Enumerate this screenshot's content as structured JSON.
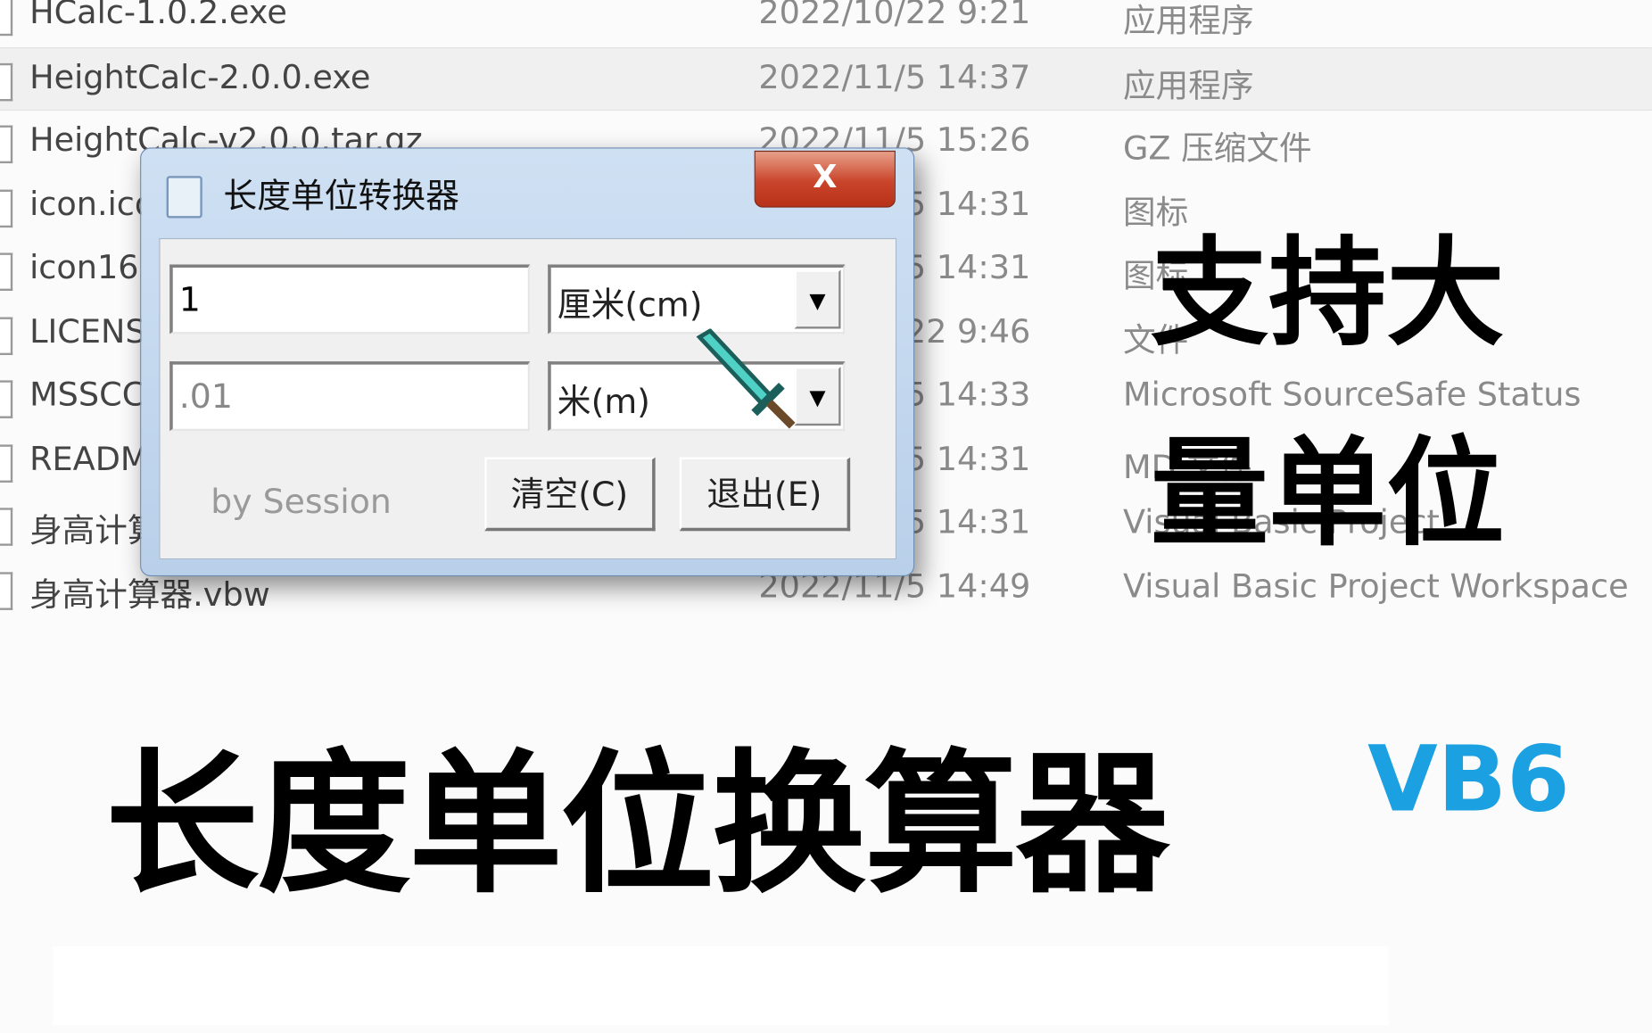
{
  "file_list": [
    {
      "name": "HCalc-1.0.2.exe",
      "date": "2022/10/22 9:21",
      "type": "应用程序"
    },
    {
      "name": "HeightCalc-2.0.0.exe",
      "date": "2022/11/5 14:37",
      "type": "应用程序",
      "selected": true
    },
    {
      "name": "HeightCalc-v2.0.0.tar.gz",
      "date": "2022/11/5 15:26",
      "type": "GZ 压缩文件"
    },
    {
      "name": "icon.ico",
      "date": "2022/11/5 14:31",
      "type": "图标"
    },
    {
      "name": "icon16.ico",
      "date": "2022/11/5 14:31",
      "type": "图标"
    },
    {
      "name": "LICENSE",
      "date": "2022/10/22 9:46",
      "type": "文件"
    },
    {
      "name": "MSSCCPRJ.SCC",
      "date": "2022/11/5 14:33",
      "type": "Microsoft SourceSafe Status"
    },
    {
      "name": "README.md",
      "date": "2022/11/5 14:31",
      "type": "MD 文件"
    },
    {
      "name": "身高计算器.vbp",
      "date": "2022/11/5 14:31",
      "type": "Visual Basic Project"
    },
    {
      "name": "身高计算器.vbw",
      "date": "2022/11/5 14:49",
      "type": "Visual Basic Project Workspace"
    }
  ],
  "dialog": {
    "title": "长度单位转换器",
    "close_label": "X",
    "input_value": "1",
    "input_unit": "厘米(cm)",
    "output_value": ".01",
    "output_unit": "米(m)",
    "credit": "by Session",
    "clear_button": "清空(C)",
    "exit_button": "退出(E)"
  },
  "overlay": {
    "main_title": "长度单位换算器",
    "subtitle_line1": "支持大",
    "subtitle_line2": "量单位",
    "tag": "VB6",
    "tag_color": "#1ba1e2"
  },
  "icons": {
    "cursor": "diamond-sword-cursor-icon",
    "app": "calculator-icon"
  }
}
